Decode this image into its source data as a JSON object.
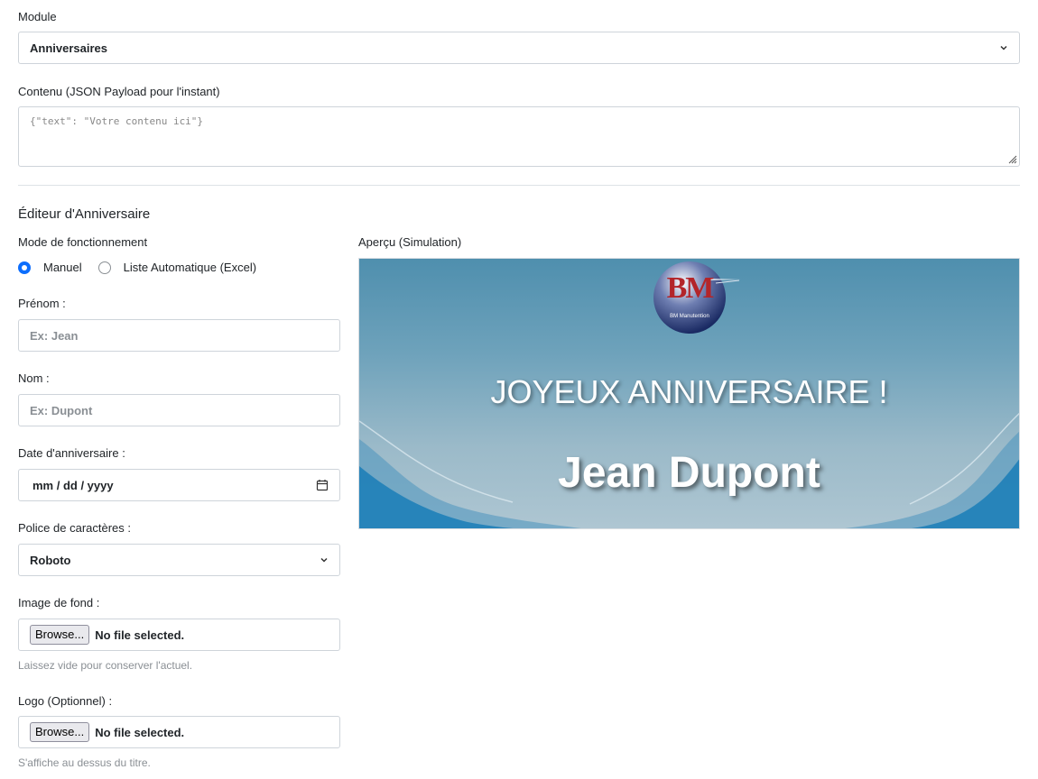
{
  "module": {
    "label": "Module",
    "selected": "Anniversaires"
  },
  "content": {
    "label": "Contenu (JSON Payload pour l'instant)",
    "placeholder": "{\"text\": \"Votre contenu ici\"}"
  },
  "editor": {
    "heading": "Éditeur d'Anniversaire",
    "mode": {
      "label": "Mode de fonctionnement",
      "options": [
        {
          "label": "Manuel",
          "checked": true
        },
        {
          "label": "Liste Automatique (Excel)",
          "checked": false
        }
      ]
    },
    "firstname": {
      "label": "Prénom :",
      "placeholder": "Ex: Jean"
    },
    "lastname": {
      "label": "Nom :",
      "placeholder": "Ex: Dupont"
    },
    "birthday": {
      "label": "Date d'anniversaire :",
      "value": "mm / dd / yyyy"
    },
    "font": {
      "label": "Police de caractères :",
      "selected": "Roboto"
    },
    "background": {
      "label": "Image de fond :",
      "button": "Browse...",
      "status": "No file selected.",
      "help": "Laissez vide pour conserver l'actuel."
    },
    "logo": {
      "label": "Logo (Optionnel) :",
      "button": "Browse...",
      "status": "No file selected.",
      "help": "S'affiche au dessus du titre."
    }
  },
  "preview": {
    "label": "Aperçu (Simulation)",
    "logo_monogram": "BM",
    "logo_caption": "BM Manutention",
    "title": "JOYEUX ANNIVERSAIRE !",
    "name": "Jean Dupont"
  },
  "colors": {
    "accent": "#0d6efd",
    "border": "#ced4da",
    "preview_top": "#4f8fae",
    "preview_bottom": "#aec6d2",
    "wave": "#1f7fb8"
  }
}
